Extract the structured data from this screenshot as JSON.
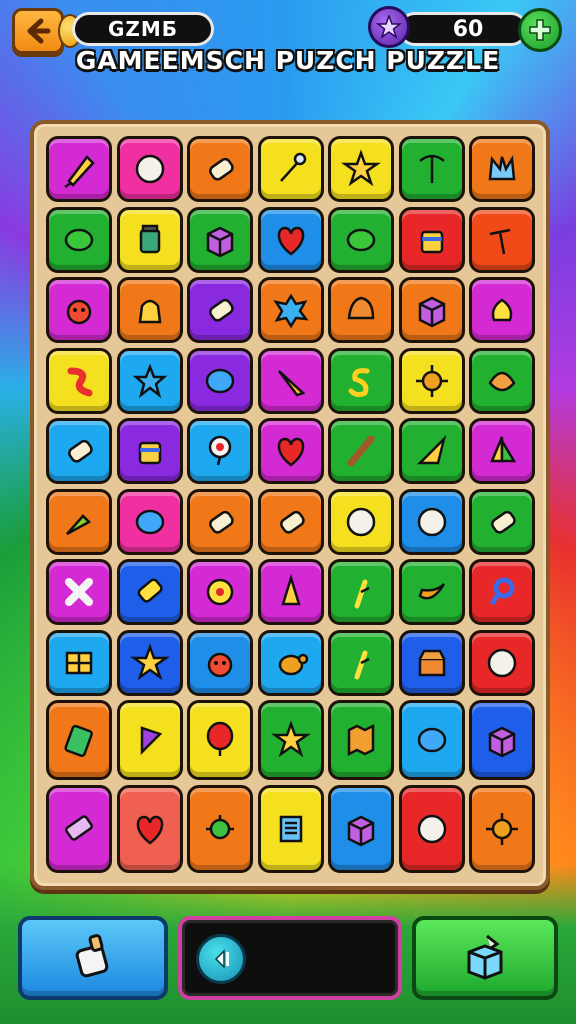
{
  "hud": {
    "back_icon": "arrow-left-icon",
    "title_label": "GZMБ",
    "score": "60",
    "star_icon": "star-badge-icon",
    "plus_icon": "plus-gear-icon"
  },
  "title": "GAMEEMSCH PUZCH  PUZZLE",
  "board": {
    "rows": [
      [
        {
          "color": "#d42ad4",
          "icon": "corn"
        },
        {
          "color": "#f030a0",
          "icon": "ball"
        },
        {
          "color": "#f07818",
          "icon": "bottle"
        },
        {
          "color": "#f5e020",
          "icon": "wrench"
        },
        {
          "color": "#f5e020",
          "icon": "star"
        },
        {
          "color": "#22b030",
          "icon": "pickaxe"
        },
        {
          "color": "#f07818",
          "icon": "crown"
        }
      ],
      [
        {
          "color": "#22b030",
          "icon": "leaf"
        },
        {
          "color": "#f5e020",
          "icon": "jar"
        },
        {
          "color": "#22b030",
          "icon": "box"
        },
        {
          "color": "#1e8ee8",
          "icon": "heart"
        },
        {
          "color": "#22b030",
          "icon": "leaf"
        },
        {
          "color": "#e82828",
          "icon": "drum"
        },
        {
          "color": "#f04a18",
          "icon": "hammer"
        }
      ],
      [
        {
          "color": "#d42ad4",
          "icon": "critter"
        },
        {
          "color": "#f07818",
          "icon": "sack"
        },
        {
          "color": "#8a2ae0",
          "icon": "bottle"
        },
        {
          "color": "#f07818",
          "icon": "splat"
        },
        {
          "color": "#f07818",
          "icon": "shell"
        },
        {
          "color": "#f07818",
          "icon": "box"
        },
        {
          "color": "#d42ad4",
          "icon": "lamp"
        }
      ],
      [
        {
          "color": "#f5e020",
          "icon": "snake"
        },
        {
          "color": "#1ea8f0",
          "icon": "star-fish"
        },
        {
          "color": "#8a2ae0",
          "icon": "gem"
        },
        {
          "color": "#d42ad4",
          "icon": "feather"
        },
        {
          "color": "#22b030",
          "icon": "swirl"
        },
        {
          "color": "#f5e020",
          "icon": "sun"
        },
        {
          "color": "#22b030",
          "icon": "melon"
        }
      ],
      [
        {
          "color": "#1ea8f0",
          "icon": "bottle"
        },
        {
          "color": "#8a2ae0",
          "icon": "drum"
        },
        {
          "color": "#1ea8f0",
          "icon": "pin"
        },
        {
          "color": "#d42ad4",
          "icon": "heart"
        },
        {
          "color": "#22b030",
          "icon": "stick"
        },
        {
          "color": "#22b030",
          "icon": "cone"
        },
        {
          "color": "#d42ad4",
          "icon": "sail"
        }
      ],
      [
        {
          "color": "#f07818",
          "icon": "carrot"
        },
        {
          "color": "#f030a0",
          "icon": "gem"
        },
        {
          "color": "#f07818",
          "icon": "bottle"
        },
        {
          "color": "#f07818",
          "icon": "bottle"
        },
        {
          "color": "#f5e020",
          "icon": "ball"
        },
        {
          "color": "#1e8ee8",
          "icon": "ball"
        },
        {
          "color": "#22b030",
          "icon": "bottle"
        }
      ],
      [
        {
          "color": "#d42ad4",
          "icon": "cross"
        },
        {
          "color": "#1e5ee8",
          "icon": "battery"
        },
        {
          "color": "#d42ad4",
          "icon": "flower"
        },
        {
          "color": "#d42ad4",
          "icon": "bell"
        },
        {
          "color": "#22b030",
          "icon": "sprout"
        },
        {
          "color": "#22b030",
          "icon": "banana"
        },
        {
          "color": "#e82828",
          "icon": "ring"
        }
      ],
      [
        {
          "color": "#1ea8f0",
          "icon": "window"
        },
        {
          "color": "#1e5ee8",
          "icon": "star"
        },
        {
          "color": "#1e8ee8",
          "icon": "critter"
        },
        {
          "color": "#1ea8f0",
          "icon": "turtle"
        },
        {
          "color": "#22b030",
          "icon": "sprout"
        },
        {
          "color": "#1e5ee8",
          "icon": "chest"
        },
        {
          "color": "#e82828",
          "icon": "ball"
        }
      ],
      [
        {
          "color": "#f07818",
          "icon": "phone"
        },
        {
          "color": "#f5e020",
          "icon": "flag"
        },
        {
          "color": "#f5e020",
          "icon": "balloon"
        },
        {
          "color": "#22b030",
          "icon": "star"
        },
        {
          "color": "#22b030",
          "icon": "map"
        },
        {
          "color": "#1ea8f0",
          "icon": "gem"
        },
        {
          "color": "#1e5ee8",
          "icon": "box"
        }
      ],
      [
        {
          "color": "#d42ad4",
          "icon": "eraser"
        },
        {
          "color": "#f06050",
          "icon": "heart"
        },
        {
          "color": "#f07818",
          "icon": "bug"
        },
        {
          "color": "#f5e020",
          "icon": "note"
        },
        {
          "color": "#1e8ee8",
          "icon": "box"
        },
        {
          "color": "#e82828",
          "icon": "ball"
        },
        {
          "color": "#f07818",
          "icon": "sun"
        }
      ]
    ]
  },
  "bottom": {
    "left_icon": "bottle-powerup-icon",
    "mid_icon": "sound-icon",
    "mid_text": "",
    "right_icon": "box-powerup-icon"
  }
}
